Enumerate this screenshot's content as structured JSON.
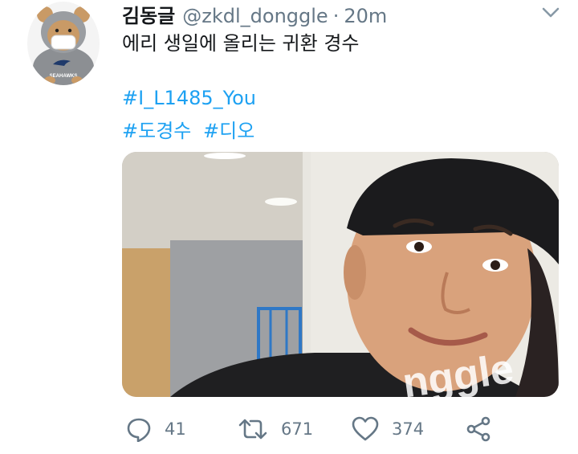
{
  "tweet": {
    "display_name": "김동글",
    "handle": "@zkdl_donggle",
    "separator": "·",
    "time": "20m",
    "text": "에리 생일에 올리는 귀환 경수",
    "hashtags": [
      "#I_L1485_You",
      "#도경수",
      "#디오"
    ]
  },
  "avatar": {
    "badge_text": "SEAHAWKS"
  },
  "media": {
    "watermark": "nggle"
  },
  "actions": {
    "reply_count": "41",
    "retweet_count": "671",
    "like_count": "374"
  },
  "icons": {
    "menu": "chevron-down-icon",
    "reply": "reply-icon",
    "retweet": "retweet-icon",
    "like": "heart-icon",
    "share": "share-icon"
  },
  "colors": {
    "text": "#14171a",
    "muted": "#657786",
    "link": "#1da1f2"
  }
}
